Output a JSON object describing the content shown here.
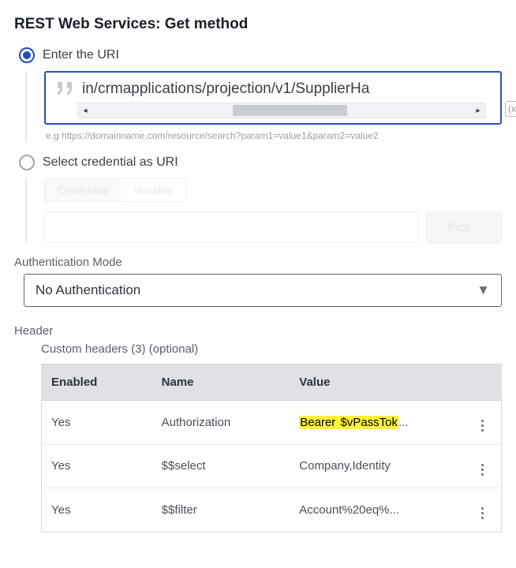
{
  "title": "REST Web Services: Get method",
  "uri_option": {
    "label": "Enter the URI",
    "value": "in/crmapplications/projection/v1/SupplierHa",
    "hint": "e.g https://domainname.com/resource/search?param1=value1&param2=value2",
    "var_badge": "(x)"
  },
  "cred_option": {
    "label": "Select credential as URI",
    "segments": {
      "credential": "Credential",
      "variable": "Variable"
    },
    "pick_label": "Pick..."
  },
  "auth": {
    "label": "Authentication Mode",
    "value": "No Authentication"
  },
  "header": {
    "label": "Header",
    "custom_label": "Custom headers (3) (optional)",
    "columns": {
      "enabled": "Enabled",
      "name": "Name",
      "value": "Value"
    },
    "rows": [
      {
        "enabled": "Yes",
        "name": "Authorization",
        "value_prefix": "Bearer ",
        "value_hl": "$vPassTok",
        "value_suffix": "..."
      },
      {
        "enabled": "Yes",
        "name": "$$select",
        "value": "Company,Identity"
      },
      {
        "enabled": "Yes",
        "name": "$$filter",
        "value": "Account%20eq%..."
      }
    ]
  }
}
